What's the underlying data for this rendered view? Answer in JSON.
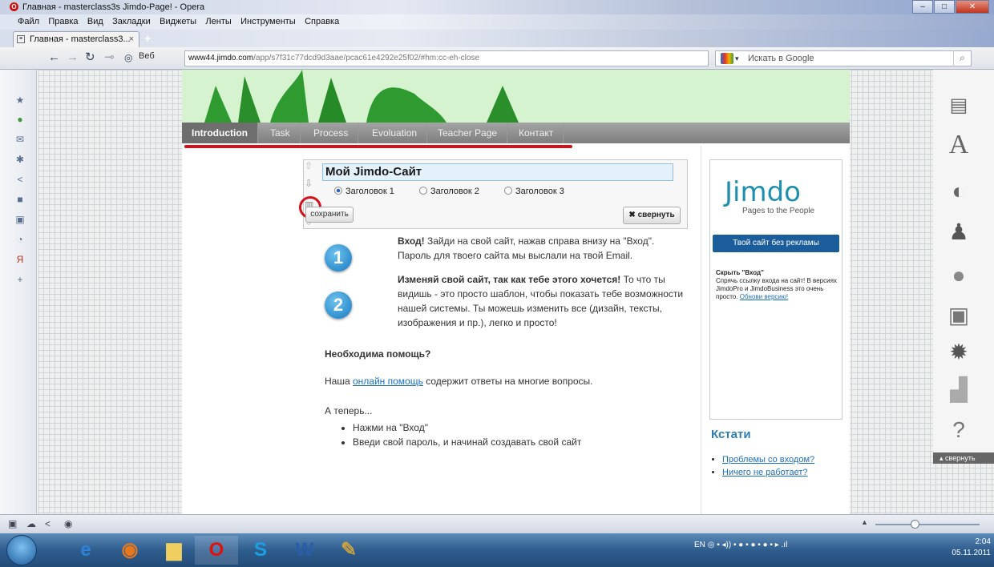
{
  "window": {
    "title": "Главная - masterclass3s Jimdo-Page! - Opera"
  },
  "menu": [
    "Файл",
    "Правка",
    "Вид",
    "Закладки",
    "Виджеты",
    "Ленты",
    "Инструменты",
    "Справка"
  ],
  "tab": {
    "label": "Главная - masterclass3...",
    "close": "×",
    "new": "+"
  },
  "nav": {
    "web_label": "Веб",
    "url_host": "www44.jimdo.com",
    "url_path": "/app/s7f31c77dcd9d3aae/pcac61e4292e25f02/#hm:cc-eh-close",
    "search_placeholder": "Искать в Google"
  },
  "site_nav": [
    "Introduction",
    "Task",
    "Process",
    "Evoluation",
    "Teacher Page",
    "Контакт"
  ],
  "editor": {
    "title_value": "Мой Jimdo-Сайт",
    "h1": "Заголовок 1",
    "h2": "Заголовок 2",
    "h3": "Заголовок 3",
    "save": "сохранить",
    "collapse": "свернуть"
  },
  "content": {
    "step1_bold": "Вход!",
    "step1_text": " Зайди на свой сайт, нажав справа внизу на \"Вход\". Пароль для твоего сайта мы выслали на твой Email.",
    "step2_bold": "Изменяй свой сайт, так как тебе этого хочется!",
    "step2_text": " То что ты видишь - это просто шаблон, чтобы показать тебе возможности нашей системы. Ты можешь изменить все (дизайн, тексты, изображения и пр.), легко и просто!",
    "help_title": "Необходима помощь?",
    "help_pre": "Наша ",
    "help_link": "онлайн помощь",
    "help_post": " содержит ответы на многие вопросы.",
    "now": "А теперь...",
    "bullets": [
      "Нажми на \"Вход\"",
      "Введи свой пароль, и начинай создавать свой сайт"
    ],
    "badge1": "1",
    "badge2": "2"
  },
  "sidebar": {
    "logo": "Jimdo",
    "logo_sub": "Pages to the People",
    "ad_button": "Твой сайт без рекламы",
    "hide_title": "Скрыть \"Вход\"",
    "hide_text": "Спрячь ссылку входа на сайт! В версиях JimdoPro и JimdoBusiness это очень просто.",
    "hide_link": "Обнови версию!",
    "kstati": "Кстати",
    "links": [
      "Проблемы со входом?",
      "Ничего не работает?"
    ]
  },
  "right_panel": {
    "collapse": "свернуть"
  },
  "taskbar": {
    "lang": "EN",
    "time": "2:04",
    "date": "05.11.2011"
  },
  "colors": {
    "accent_red": "#d4101a",
    "jimdo_blue": "#1b5d9a",
    "nav_gray": "#8a8a8a",
    "banner_green": "#d5f3cf"
  }
}
